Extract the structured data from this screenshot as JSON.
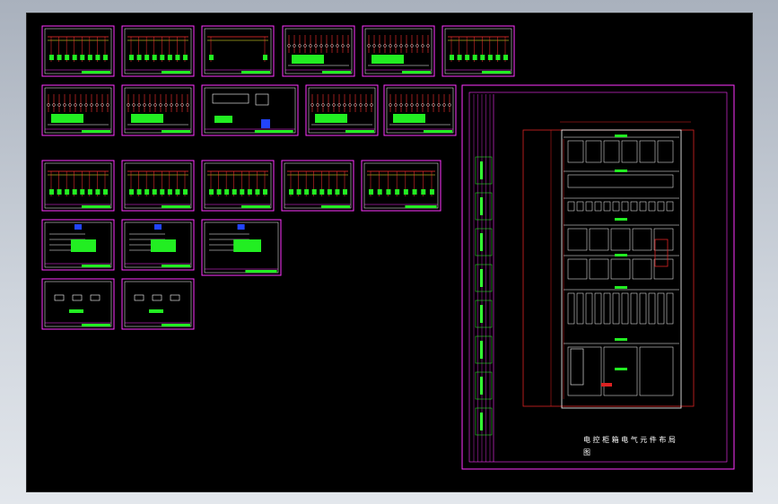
{
  "canvas": {
    "background": "#000000",
    "outer_background": "#c3cad3"
  },
  "colors": {
    "frame": "#ff33ff",
    "sheet_border": "#ffffff",
    "wire_red": "#ff3030",
    "wire_yellow": "#ffff33",
    "component_green": "#22ee22",
    "accent_blue": "#2244ff",
    "dimension_red": "#dd2222",
    "title_block_green": "#33ff33"
  },
  "large_sheet": {
    "caption_line1": "电 控 柜 箱 电 气 元 件 布 局",
    "caption_line2": "图"
  },
  "thumbnail_sheets": {
    "row_counts": [
      6,
      5,
      5,
      3,
      2
    ],
    "total": 21
  }
}
